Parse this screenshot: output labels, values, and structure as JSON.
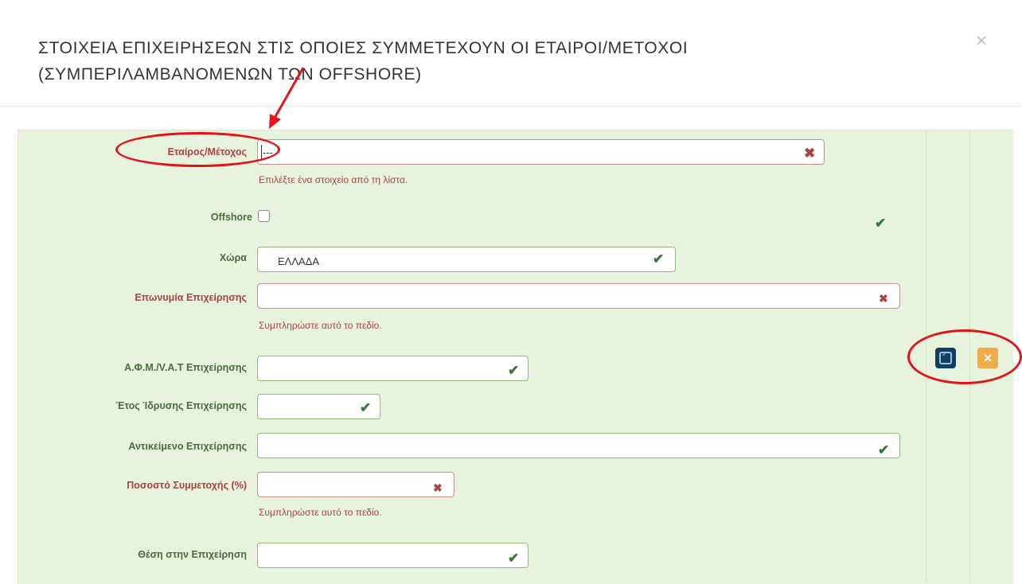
{
  "modal": {
    "title": "ΣΤΟΙΧΕΙΑ ΕΠΙΧΕΙΡΗΣΕΩΝ ΣΤΙΣ ΟΠΟΙΕΣ ΣΥΜΜΕΤΕΧΟΥΝ ΟΙ ΕΤΑΙΡΟΙ/ΜΕΤΟΧΟΙ (ΣΥΜΠΕΡΙΛΑΜΒΑΝΟΜΕΝΩΝ ΤΩΝ OFFSHORE)",
    "close_symbol": "×"
  },
  "form": {
    "partner": {
      "label": "Εταίρος/Μέτοχος",
      "value": "---",
      "help": "Επιλέξτε ένα στοιχείο από τη λίστα."
    },
    "offshore": {
      "label": "Offshore",
      "checked": false
    },
    "country": {
      "label": "Χώρα",
      "value": "ΕΛΛΑΔΑ"
    },
    "company_name": {
      "label": "Επωνυμία Επιχείρησης",
      "value": "",
      "help": "Συμπληρώστε αυτό το πεδίο."
    },
    "vat": {
      "label": "Α.Φ.Μ./V.A.T Επιχείρησης",
      "value": ""
    },
    "year": {
      "label": "Έτος Ίδρυσης Επιχείρησης",
      "value": ""
    },
    "activity": {
      "label": "Αντικείμενο Επιχείρησης",
      "value": ""
    },
    "percentage": {
      "label": "Ποσοστό Συμμετοχής (%)",
      "value": "",
      "help": "Συμπληρώστε αυτό το πεδίο."
    },
    "position": {
      "label": "Θέση στην Επιχείρηση",
      "value": ""
    }
  },
  "icons": {
    "valid": "check-icon",
    "invalid": "cross-icon"
  },
  "colors": {
    "panel_bg": "#e8f3dd",
    "error": "#a94442",
    "success": "#3c763d",
    "save_button": "#163d5c",
    "cancel_button": "#f0ad4e",
    "annotation": "#e3131a"
  }
}
